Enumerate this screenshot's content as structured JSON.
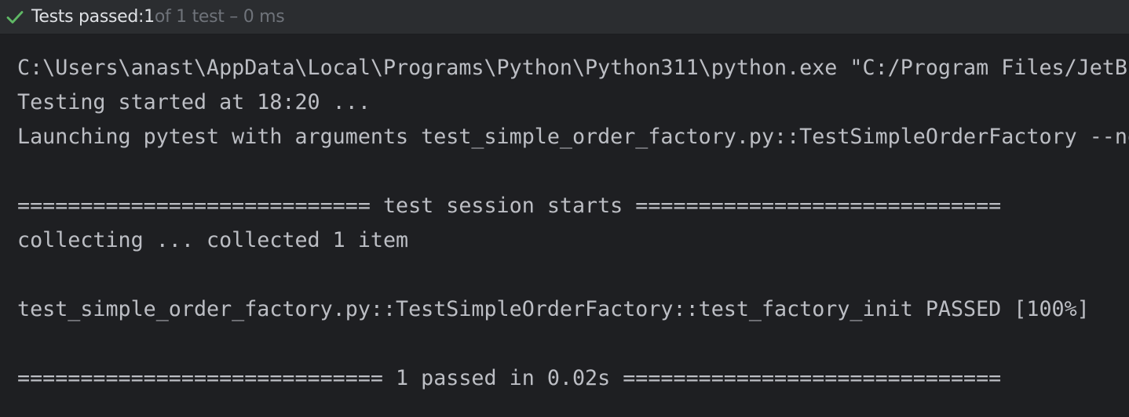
{
  "status": {
    "icon": "checkmark-icon",
    "icon_color": "#5fb865",
    "label": "Tests passed: ",
    "passed_count": "1",
    "detail": " of 1 test – 0 ms"
  },
  "console": {
    "lines": [
      "C:\\Users\\anast\\AppData\\Local\\Programs\\Python\\Python311\\python.exe \"C:/Program Files/JetBr",
      "Testing started at 18:20 ...",
      "Launching pytest with arguments test_simple_order_factory.py::TestSimpleOrderFactory --no",
      "",
      "============================ test session starts =============================",
      "collecting ... collected 1 item",
      "",
      "test_simple_order_factory.py::TestSimpleOrderFactory::test_factory_init PASSED [100%]",
      "",
      "============================= 1 passed in 0.02s =============================="
    ]
  }
}
